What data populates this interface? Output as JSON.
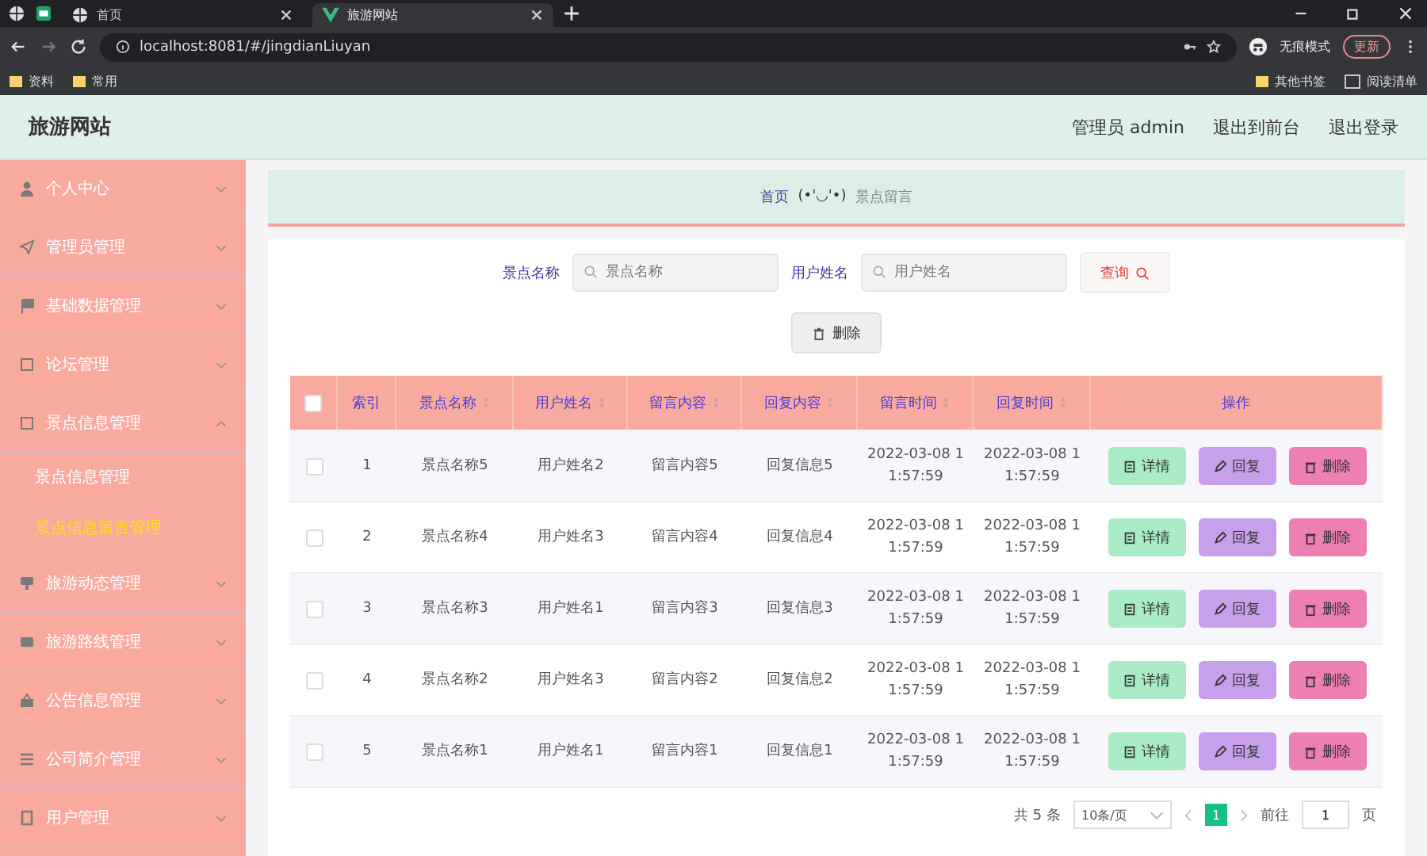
{
  "browser": {
    "tabs": [
      {
        "title": "首页",
        "selected": false
      },
      {
        "title": "旅游网站",
        "selected": true
      }
    ],
    "address": "localhost:8081/#/jingdianLiuyan",
    "incognito_label": "无痕模式",
    "update_button": "更新",
    "bookmarks": [
      "资料",
      "常用"
    ],
    "bookmarks_right": [
      "其他书签",
      "阅读清单"
    ]
  },
  "header": {
    "title": "旅游网站",
    "links": [
      "管理员 admin",
      "退出到前台",
      "退出登录"
    ]
  },
  "sidebar": {
    "items": [
      {
        "label": "个人中心",
        "expanded": false
      },
      {
        "label": "管理员管理",
        "expanded": false
      },
      {
        "label": "基础数据管理",
        "expanded": false
      },
      {
        "label": "论坛管理",
        "expanded": false
      },
      {
        "label": "景点信息管理",
        "expanded": true,
        "children": [
          {
            "label": "景点信息管理",
            "selected": false
          },
          {
            "label": "景点信息留言管理",
            "selected": true
          }
        ]
      },
      {
        "label": "旅游动态管理",
        "expanded": false
      },
      {
        "label": "旅游路线管理",
        "expanded": false
      },
      {
        "label": "公告信息管理",
        "expanded": false
      },
      {
        "label": "公司简介管理",
        "expanded": false
      },
      {
        "label": "用户管理",
        "expanded": false
      }
    ]
  },
  "breadcrumb": {
    "home": "首页",
    "separator": "(•'◡'•)",
    "current": "景点留言"
  },
  "search": {
    "fields": [
      {
        "label": "景点名称",
        "placeholder": "景点名称"
      },
      {
        "label": "用户姓名",
        "placeholder": "用户姓名"
      }
    ],
    "button": "查询",
    "delete_button": "删除"
  },
  "table": {
    "header_checked": false,
    "columns": [
      {
        "label": "索引",
        "sortable": false
      },
      {
        "label": "景点名称",
        "sortable": true
      },
      {
        "label": "用户姓名",
        "sortable": true
      },
      {
        "label": "留言内容",
        "sortable": true
      },
      {
        "label": "回复内容",
        "sortable": true
      },
      {
        "label": "留言时间",
        "sortable": true
      },
      {
        "label": "回复时间",
        "sortable": true
      },
      {
        "label": "操作",
        "sortable": false
      }
    ],
    "rows": [
      {
        "checked": false,
        "cells": [
          "1",
          "景点名称5",
          "用户姓名2",
          "留言内容5",
          "回复信息5",
          "2022-03-08 1\n1:57:59",
          "2022-03-08 1\n1:57:59"
        ],
        "actions": [
          "详情",
          "回复",
          "删除"
        ]
      },
      {
        "checked": false,
        "cells": [
          "2",
          "景点名称4",
          "用户姓名3",
          "留言内容4",
          "回复信息4",
          "2022-03-08 1\n1:57:59",
          "2022-03-08 1\n1:57:59"
        ],
        "actions": [
          "详情",
          "回复",
          "删除"
        ]
      },
      {
        "checked": false,
        "cells": [
          "3",
          "景点名称3",
          "用户姓名1",
          "留言内容3",
          "回复信息3",
          "2022-03-08 1\n1:57:59",
          "2022-03-08 1\n1:57:59"
        ],
        "actions": [
          "详情",
          "回复",
          "删除"
        ]
      },
      {
        "checked": false,
        "cells": [
          "4",
          "景点名称2",
          "用户姓名3",
          "留言内容2",
          "回复信息2",
          "2022-03-08 1\n1:57:59",
          "2022-03-08 1\n1:57:59"
        ],
        "actions": [
          "详情",
          "回复",
          "删除"
        ]
      },
      {
        "checked": false,
        "cells": [
          "5",
          "景点名称1",
          "用户姓名1",
          "留言内容1",
          "回复信息1",
          "2022-03-08 1\n1:57:59",
          "2022-03-08 1\n1:57:59"
        ],
        "actions": [
          "详情",
          "回复",
          "删除"
        ]
      }
    ]
  },
  "pagination": {
    "total": "共 5 条",
    "page_size": "10条/页",
    "pages": [
      {
        "label": "1",
        "selected": true
      }
    ],
    "goto_label": "前往",
    "goto_value": "1",
    "page_suffix": "页"
  }
}
